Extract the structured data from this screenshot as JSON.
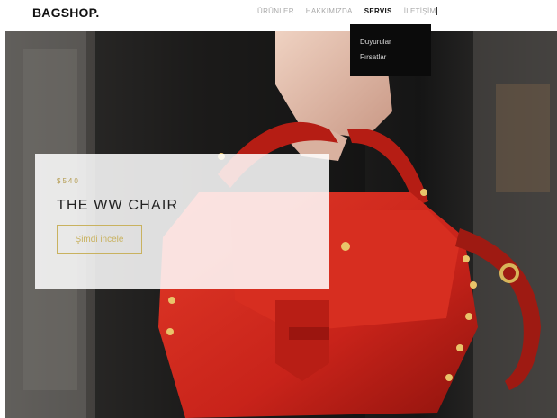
{
  "brand": {
    "name": "BAGSHOP."
  },
  "nav": {
    "items": [
      {
        "label": "ÜRÜNLER"
      },
      {
        "label": "HAKKIMIZDA"
      },
      {
        "label": "SERVIS"
      },
      {
        "label": "İLETİŞİM"
      }
    ],
    "active": "SERVIS"
  },
  "dropdown": {
    "items": [
      {
        "label": "Duyurular"
      },
      {
        "label": "Fırsatlar"
      }
    ]
  },
  "hero": {
    "price": "$540",
    "title": "THE WW CHAIR",
    "cta_label": "Şimdi incele"
  },
  "colors": {
    "accent_gold": "#c9b25f",
    "bag_red": "#d42a1e",
    "dropdown_bg": "#0b0b0b"
  }
}
